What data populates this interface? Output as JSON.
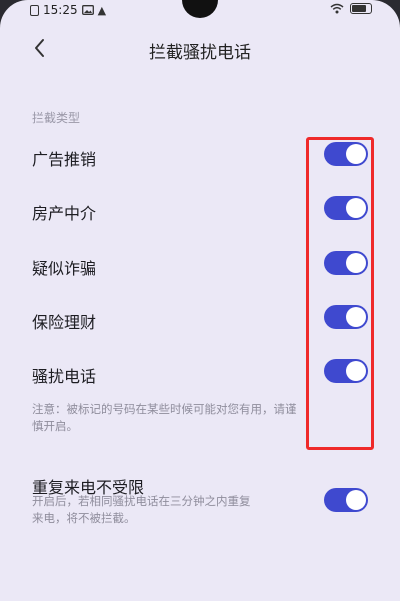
{
  "status_bar": {
    "time": "15:25",
    "extra_icon_glyph": "▲"
  },
  "header": {
    "title": "拦截骚扰电话"
  },
  "section": {
    "label": "拦截类型"
  },
  "rows": [
    {
      "label": "广告推销",
      "enabled": true
    },
    {
      "label": "房产中介",
      "enabled": true
    },
    {
      "label": "疑似诈骗",
      "enabled": true
    },
    {
      "label": "保险理财",
      "enabled": true
    },
    {
      "label": "骚扰电话",
      "enabled": true
    }
  ],
  "note1": {
    "line1": "注意：被标记的号码在某些时候可能对您有用，请谨",
    "line2": "慎开启。"
  },
  "repeat_call": {
    "label": "重复来电不受限",
    "desc_line1": "开启后，若相同骚扰电话在三分钟之内重复",
    "desc_line2": "来电，将不被拦截。",
    "enabled": true
  },
  "colors": {
    "toggle_on": "#3f49cf",
    "highlight_box": "#ef2a2a",
    "background": "#ebe8f6"
  }
}
